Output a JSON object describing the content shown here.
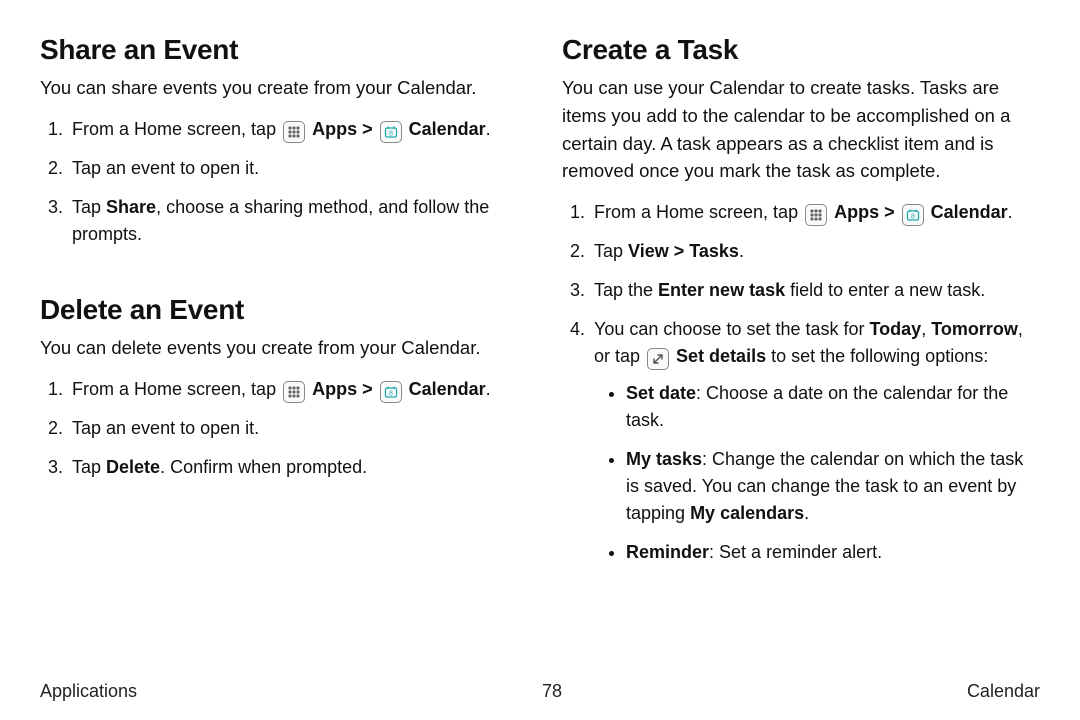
{
  "left": {
    "share": {
      "heading": "Share an Event",
      "intro": "You can share events you create from your Calendar.",
      "step1_prefix": "From a Home screen, tap ",
      "apps_label": "Apps",
      "separator": " > ",
      "calendar_label": "Calendar",
      "period": ".",
      "step2": "Tap an event to open it.",
      "step3_prefix": "Tap ",
      "step3_bold": "Share",
      "step3_suffix": ", choose a sharing method, and follow the prompts."
    },
    "delete": {
      "heading": "Delete an Event",
      "intro": "You can delete events you create from your Calendar.",
      "step1_prefix": "From a Home screen, tap ",
      "apps_label": "Apps",
      "separator": " > ",
      "calendar_label": "Calendar",
      "period": ".",
      "step2": "Tap an event to open it.",
      "step3_prefix": "Tap ",
      "step3_bold": "Delete",
      "step3_suffix": ". Confirm when prompted."
    }
  },
  "right": {
    "heading": "Create a Task",
    "intro": "You can use your Calendar to create tasks. Tasks are items you add to the calendar to be accomplished on a certain day. A task appears as a checklist item and is removed once you mark the task as complete.",
    "step1_prefix": "From a Home screen, tap ",
    "apps_label": "Apps",
    "separator": " > ",
    "calendar_label": "Calendar",
    "period": ".",
    "step2_prefix": "Tap ",
    "step2_bold": "View > Tasks",
    "step2_suffix": ".",
    "step3_prefix": "Tap the ",
    "step3_bold": "Enter new task",
    "step3_suffix": " field to enter a new task.",
    "step4_prefix": "You can choose to set the task for ",
    "step4_today": "Today",
    "step4_comma": ", ",
    "step4_tomorrow": "Tomorrow",
    "step4_mid": ", or tap ",
    "step4_setdetails": "Set details",
    "step4_suffix": " to set the following options:",
    "bullets": {
      "b1_label": "Set date",
      "b1_text": ": Choose a date on the calendar for the task.",
      "b2_label": "My tasks",
      "b2_text_a": ": Change the calendar on which the task is saved. You can change the task to an event by tapping ",
      "b2_bold": "My calendars",
      "b2_text_b": ".",
      "b3_label": "Reminder",
      "b3_text": ": Set a reminder alert."
    }
  },
  "footer": {
    "left": "Applications",
    "center": "78",
    "right": "Calendar"
  }
}
